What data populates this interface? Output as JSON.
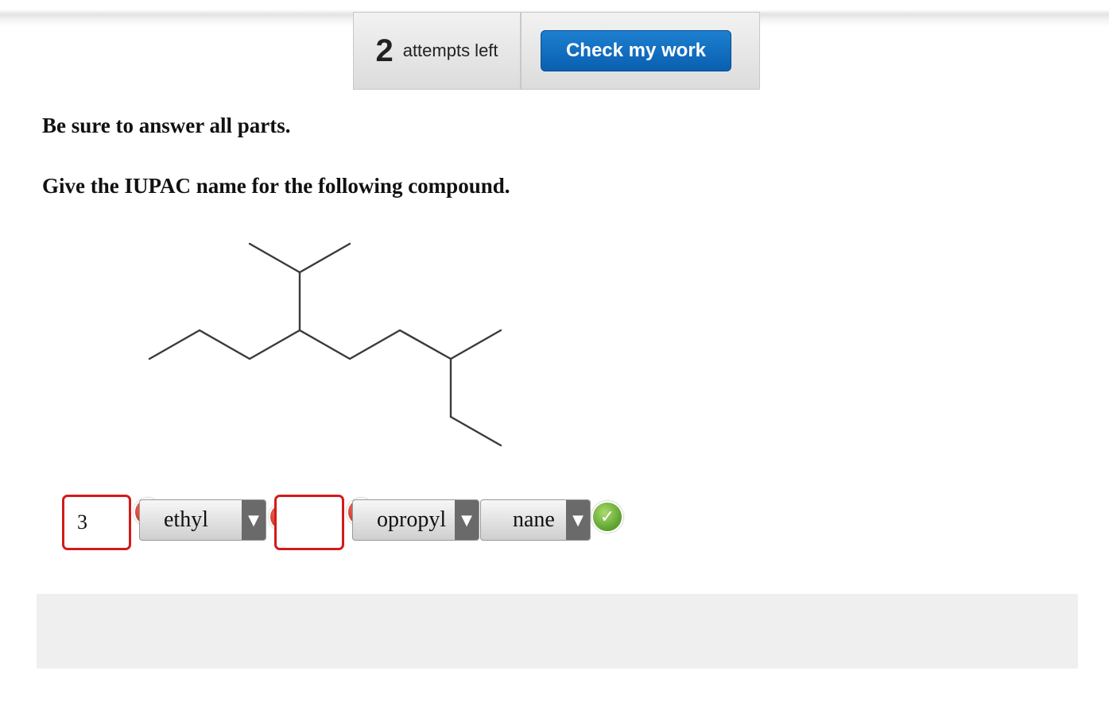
{
  "toolbar": {
    "attempts_count": "2",
    "attempts_label": "attempts left",
    "check_label": "Check my work",
    "check_color": "#0a6ac0"
  },
  "instructions": {
    "line1": "Be sure to answer all parts.",
    "line2": "Give the IUPAC name for the following compound."
  },
  "answer": {
    "field1_value": "3",
    "select1_value": "ethyl",
    "field2_value": "",
    "select2_value": "opropyl",
    "select3_value": "nane",
    "error_icon": "x-circle-icon",
    "ok_icon": "check-circle-icon",
    "error_color": "#d41a1a",
    "ok_color": "#5aa02a"
  }
}
